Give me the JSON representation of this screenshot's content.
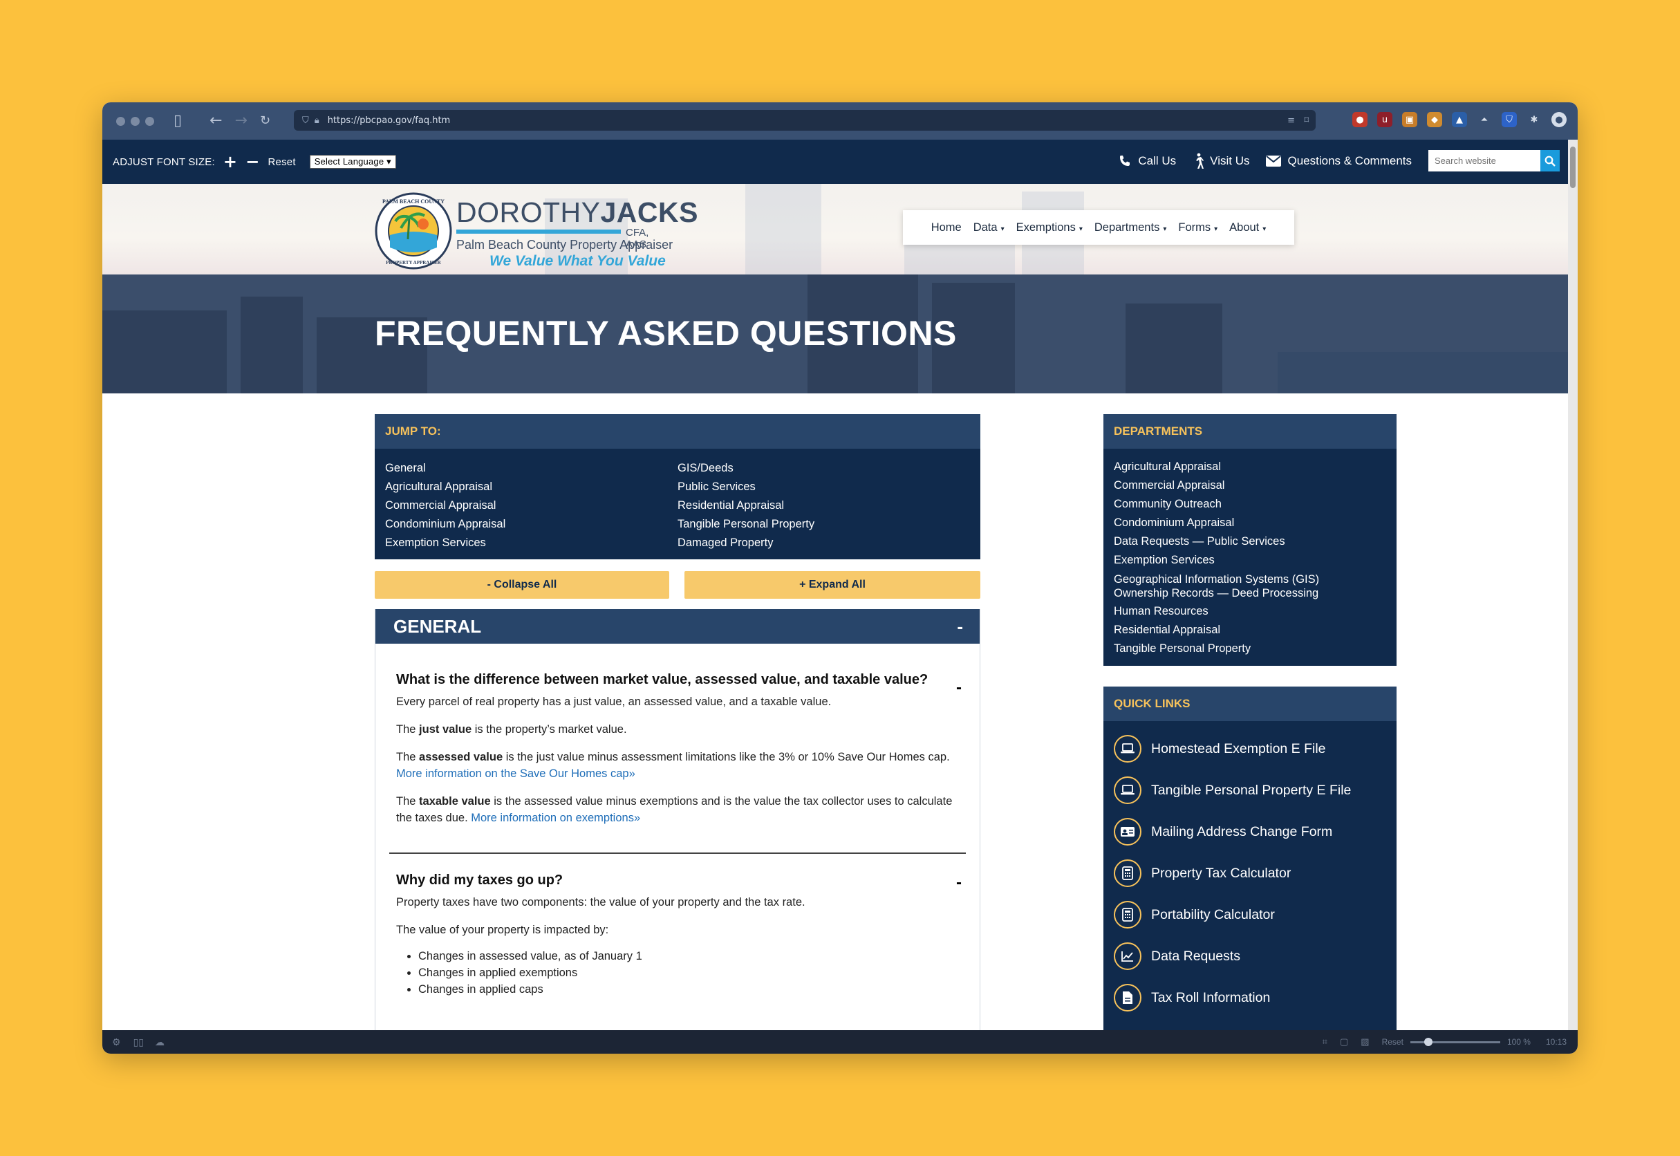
{
  "browser": {
    "url": "https://pbcpao.gov/faq.htm",
    "status": {
      "reset": "Reset",
      "zoom": "100 %",
      "time": "10:13"
    }
  },
  "utility": {
    "font_size_label": "ADJUST FONT SIZE:",
    "increase": "+",
    "decrease": "−",
    "reset": "Reset",
    "language": "Select Language",
    "call": "Call Us",
    "visit": "Visit Us",
    "questions": "Questions & Comments",
    "search_placeholder": "Search website"
  },
  "logo": {
    "name_light": "DOROTHY",
    "name_bold": "JACKS",
    "credentials": "CFA, AAS",
    "office": "Palm Beach County Property Appraiser",
    "slogan": "We Value What You Value",
    "seal_text": "PALM BEACH COUNTY PROPERTY APPRAISER"
  },
  "nav": {
    "home": "Home",
    "data": "Data",
    "exemptions": "Exemptions",
    "departments": "Departments",
    "forms": "Forms",
    "about": "About"
  },
  "hero": {
    "title": "FREQUENTLY ASKED QUESTIONS"
  },
  "jump": {
    "title": "JUMP TO:",
    "left": [
      "General",
      "Agricultural Appraisal",
      "Commercial Appraisal",
      "Condominium Appraisal",
      "Exemption Services"
    ],
    "right": [
      "GIS/Deeds",
      "Public Services",
      "Residential Appraisal",
      "Tangible Personal Property",
      "Damaged Property"
    ]
  },
  "buttons": {
    "collapse": "- Collapse All",
    "expand": "+ Expand All"
  },
  "faq": {
    "section": "GENERAL",
    "section_toggle": "-",
    "q1": {
      "question": "What is the difference between market value, assessed value, and taxable value?",
      "toggle": "-",
      "p1": "Every parcel of real property has a just value, an assessed value, and a taxable value.",
      "p2_pre": "The ",
      "p2_bold": "just value",
      "p2_post": " is the property’s market value.",
      "p3_pre": "The ",
      "p3_bold": "assessed value",
      "p3_post": " is the just value minus assessment limitations like the 3% or 10% Save Our Homes cap.",
      "p3_link": "More information on the Save Our Homes cap»",
      "p4_pre": "The ",
      "p4_bold": "taxable value",
      "p4_post": " is the assessed value minus exemptions and is the value the tax collector uses to calculate the taxes due. ",
      "p4_link": "More information on exemptions»"
    },
    "q2": {
      "question": "Why did my taxes go up?",
      "toggle": "-",
      "p1": "Property taxes have two components: the value of your property and the tax rate.",
      "p2": "The value of your property is impacted by:",
      "bullets": [
        "Changes in assessed value, as of January 1",
        "Changes in applied exemptions",
        "Changes in applied caps"
      ]
    }
  },
  "departments": {
    "title": "DEPARTMENTS",
    "items": [
      "Agricultural Appraisal",
      "Commercial Appraisal",
      "Community Outreach",
      "Condominium Appraisal",
      "Data Requests — Public Services",
      "Exemption Services",
      "Geographical Information Systems (GIS) Ownership Records — Deed Processing",
      "Human Resources",
      "Residential Appraisal",
      "Tangible Personal Property"
    ]
  },
  "quicklinks": {
    "title": "QUICK LINKS",
    "items": [
      {
        "label": "Homestead Exemption E File",
        "icon": "laptop-icon"
      },
      {
        "label": "Tangible Personal Property E File",
        "icon": "laptop-icon"
      },
      {
        "label": "Mailing Address Change Form",
        "icon": "id-card-icon"
      },
      {
        "label": "Property Tax Calculator",
        "icon": "calculator-icon"
      },
      {
        "label": "Portability Calculator",
        "icon": "calculator-icon"
      },
      {
        "label": "Data Requests",
        "icon": "chart-icon"
      },
      {
        "label": "Tax Roll Information",
        "icon": "document-icon"
      }
    ]
  }
}
